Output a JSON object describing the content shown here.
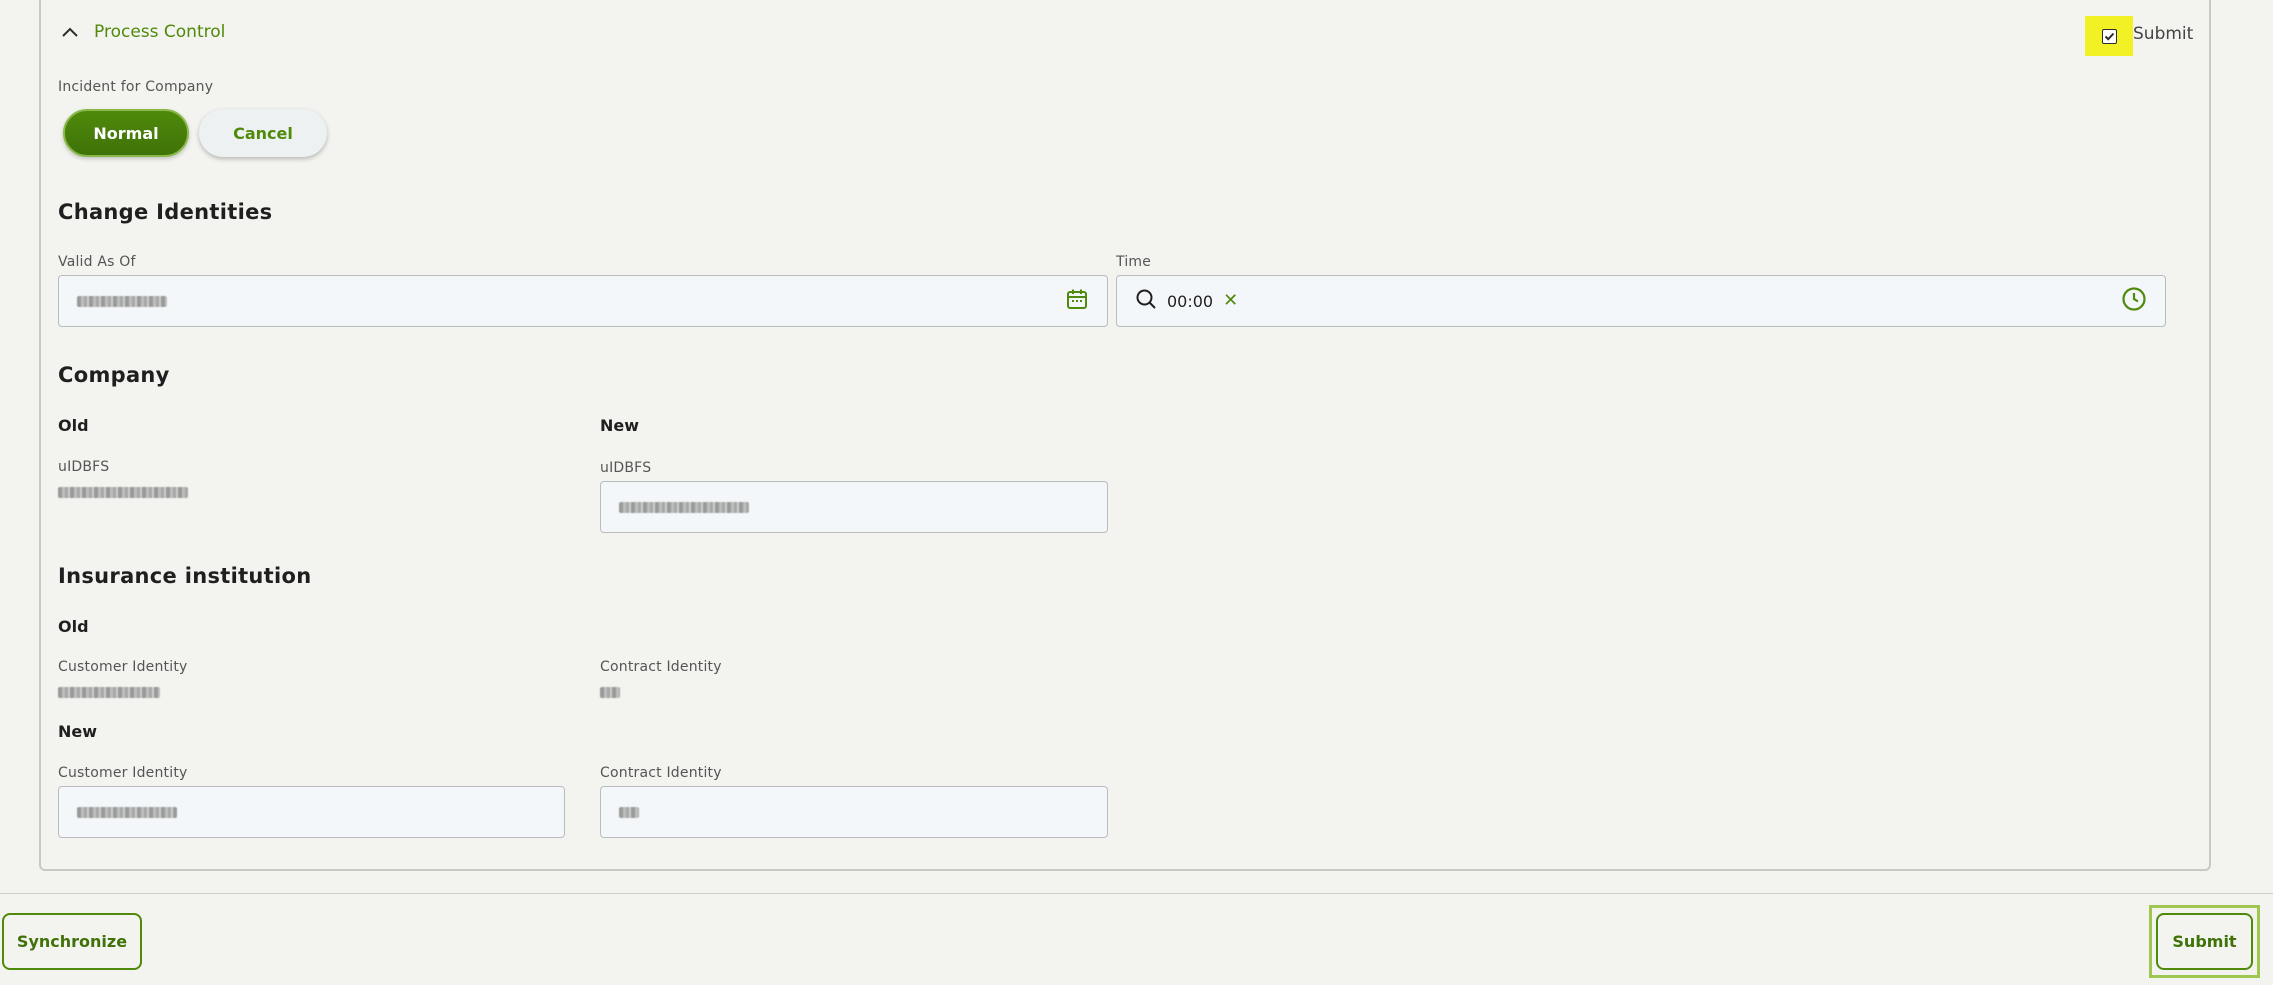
{
  "section": {
    "title": "Process Control",
    "submit_checkbox_label": "Submit",
    "submit_checked": true
  },
  "incident": {
    "label": "Incident for Company",
    "normal_label": "Normal",
    "cancel_label": "Cancel"
  },
  "change_identities": {
    "heading": "Change Identities",
    "valid_as_of_label": "Valid As Of",
    "time_label": "Time",
    "time_value": "00:00"
  },
  "company": {
    "heading": "Company",
    "old_label": "Old",
    "new_label": "New",
    "old_uidbfs_label": "uIDBFS",
    "new_uidbfs_label": "uIDBFS"
  },
  "insurance": {
    "heading": "Insurance institution",
    "old_label": "Old",
    "new_label": "New",
    "old_customer_label": "Customer Identity",
    "old_contract_label": "Contract Identity",
    "new_customer_label": "Customer Identity",
    "new_contract_label": "Contract Identity"
  },
  "footer": {
    "synchronize_label": "Synchronize",
    "submit_label": "Submit"
  },
  "colors": {
    "accent": "#4f8a0b",
    "highlight": "#f1f125",
    "focus_ring": "#9fc64f"
  }
}
